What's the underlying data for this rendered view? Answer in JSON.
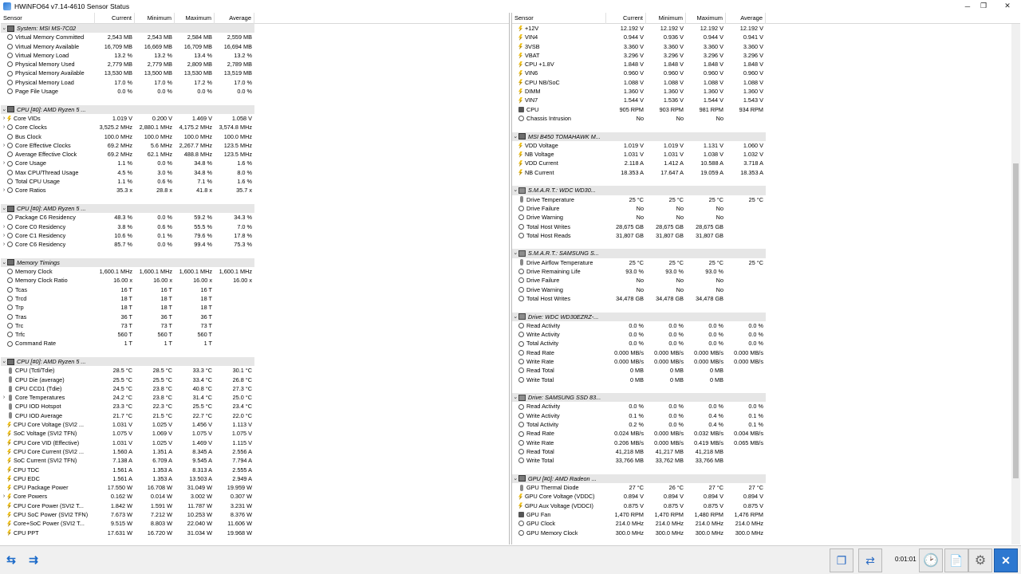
{
  "window": {
    "title": "HWiNFO64 v7.14-4610 Sensor Status"
  },
  "columns": [
    "Sensor",
    "Current",
    "Minimum",
    "Maximum",
    "Average"
  ],
  "left_rows": [
    {
      "t": "sec",
      "name": "System: MSI MS-7C02",
      "icon": "chip"
    },
    {
      "name": "Virtual Memory Committed",
      "icon": "circ",
      "v": [
        "2,543 MB",
        "2,543 MB",
        "2,584 MB",
        "2,559 MB"
      ]
    },
    {
      "name": "Virtual Memory Available",
      "icon": "circ",
      "v": [
        "16,709 MB",
        "16,669 MB",
        "16,709 MB",
        "16,694 MB"
      ]
    },
    {
      "name": "Virtual Memory Load",
      "icon": "circ",
      "v": [
        "13.2 %",
        "13.2 %",
        "13.4 %",
        "13.2 %"
      ]
    },
    {
      "name": "Physical Memory Used",
      "icon": "circ",
      "v": [
        "2,779 MB",
        "2,779 MB",
        "2,809 MB",
        "2,789 MB"
      ]
    },
    {
      "name": "Physical Memory Available",
      "icon": "circ",
      "v": [
        "13,530 MB",
        "13,500 MB",
        "13,530 MB",
        "13,519 MB"
      ]
    },
    {
      "name": "Physical Memory Load",
      "icon": "circ",
      "v": [
        "17.0 %",
        "17.0 %",
        "17.2 %",
        "17.0 %"
      ]
    },
    {
      "name": "Page File Usage",
      "icon": "circ",
      "v": [
        "0.0 %",
        "0.0 %",
        "0.0 %",
        "0.0 %"
      ]
    },
    {
      "t": "sp"
    },
    {
      "t": "sec",
      "name": "CPU [#0]: AMD Ryzen 5 ...",
      "icon": "chip"
    },
    {
      "name": "Core VIDs",
      "icon": "volt",
      "tw": ">",
      "v": [
        "1.019 V",
        "0.200 V",
        "1.469 V",
        "1.058 V"
      ]
    },
    {
      "name": "Core Clocks",
      "icon": "circ",
      "tw": ">",
      "v": [
        "3,525.2 MHz",
        "2,880.1 MHz",
        "4,175.2 MHz",
        "3,574.8 MHz"
      ]
    },
    {
      "name": "Bus Clock",
      "icon": "circ",
      "v": [
        "100.0 MHz",
        "100.0 MHz",
        "100.0 MHz",
        "100.0 MHz"
      ]
    },
    {
      "name": "Core Effective Clocks",
      "icon": "circ",
      "tw": ">",
      "v": [
        "69.2 MHz",
        "5.6 MHz",
        "2,267.7 MHz",
        "123.5 MHz"
      ]
    },
    {
      "name": "Average Effective Clock",
      "icon": "circ",
      "v": [
        "69.2 MHz",
        "62.1 MHz",
        "488.8 MHz",
        "123.5 MHz"
      ]
    },
    {
      "name": "Core Usage",
      "icon": "circ",
      "tw": ">",
      "v": [
        "1.1 %",
        "0.0 %",
        "34.8 %",
        "1.6 %"
      ]
    },
    {
      "name": "Max CPU/Thread Usage",
      "icon": "circ",
      "v": [
        "4.5 %",
        "3.0 %",
        "34.8 %",
        "8.0 %"
      ]
    },
    {
      "name": "Total CPU Usage",
      "icon": "circ",
      "v": [
        "1.1 %",
        "0.6 %",
        "7.1 %",
        "1.6 %"
      ]
    },
    {
      "name": "Core Ratios",
      "icon": "circ",
      "tw": ">",
      "v": [
        "35.3 x",
        "28.8 x",
        "41.8 x",
        "35.7 x"
      ]
    },
    {
      "t": "sp"
    },
    {
      "t": "sec",
      "name": "CPU [#0]: AMD Ryzen 5 ...",
      "icon": "chip"
    },
    {
      "name": "Package C6 Residency",
      "icon": "circ",
      "v": [
        "48.3 %",
        "0.0 %",
        "59.2 %",
        "34.3 %"
      ]
    },
    {
      "name": "Core C0 Residency",
      "icon": "circ",
      "tw": ">",
      "v": [
        "3.8 %",
        "0.6 %",
        "55.5 %",
        "7.0 %"
      ]
    },
    {
      "name": "Core C1 Residency",
      "icon": "circ",
      "tw": ">",
      "v": [
        "10.6 %",
        "0.1 %",
        "79.6 %",
        "17.8 %"
      ]
    },
    {
      "name": "Core C6 Residency",
      "icon": "circ",
      "tw": ">",
      "v": [
        "85.7 %",
        "0.0 %",
        "99.4 %",
        "75.3 %"
      ]
    },
    {
      "t": "sp"
    },
    {
      "t": "sec",
      "name": "Memory Timings",
      "icon": "chip"
    },
    {
      "name": "Memory Clock",
      "icon": "circ",
      "v": [
        "1,600.1 MHz",
        "1,600.1 MHz",
        "1,600.1 MHz",
        "1,600.1 MHz"
      ]
    },
    {
      "name": "Memory Clock Ratio",
      "icon": "circ",
      "v": [
        "16.00 x",
        "16.00 x",
        "16.00 x",
        "16.00 x"
      ]
    },
    {
      "name": "Tcas",
      "icon": "circ",
      "v": [
        "16 T",
        "16 T",
        "16 T",
        ""
      ]
    },
    {
      "name": "Trcd",
      "icon": "circ",
      "v": [
        "18 T",
        "18 T",
        "18 T",
        ""
      ]
    },
    {
      "name": "Trp",
      "icon": "circ",
      "v": [
        "18 T",
        "18 T",
        "18 T",
        ""
      ]
    },
    {
      "name": "Tras",
      "icon": "circ",
      "v": [
        "36 T",
        "36 T",
        "36 T",
        ""
      ]
    },
    {
      "name": "Trc",
      "icon": "circ",
      "v": [
        "73 T",
        "73 T",
        "73 T",
        ""
      ]
    },
    {
      "name": "Trfc",
      "icon": "circ",
      "v": [
        "560 T",
        "560 T",
        "560 T",
        ""
      ]
    },
    {
      "name": "Command Rate",
      "icon": "circ",
      "v": [
        "1 T",
        "1 T",
        "1 T",
        ""
      ]
    },
    {
      "t": "sp"
    },
    {
      "t": "sec",
      "name": "CPU [#0]: AMD Ryzen 5 ...",
      "icon": "chip"
    },
    {
      "name": "CPU (Tctl/Tdie)",
      "icon": "temp",
      "v": [
        "28.5 °C",
        "28.5 °C",
        "33.3 °C",
        "30.1 °C"
      ]
    },
    {
      "name": "CPU Die (average)",
      "icon": "temp",
      "v": [
        "25.5 °C",
        "25.5 °C",
        "33.4 °C",
        "26.8 °C"
      ]
    },
    {
      "name": "CPU CCD1 (Tdie)",
      "icon": "temp",
      "v": [
        "24.5 °C",
        "23.8 °C",
        "40.8 °C",
        "27.3 °C"
      ]
    },
    {
      "name": "Core Temperatures",
      "icon": "temp",
      "tw": ">",
      "v": [
        "24.2 °C",
        "23.8 °C",
        "31.4 °C",
        "25.0 °C"
      ]
    },
    {
      "name": "CPU IOD Hotspot",
      "icon": "temp",
      "v": [
        "23.3 °C",
        "22.3 °C",
        "25.5 °C",
        "23.4 °C"
      ]
    },
    {
      "name": "CPU IOD Average",
      "icon": "temp",
      "v": [
        "21.7 °C",
        "21.5 °C",
        "22.7 °C",
        "22.0 °C"
      ]
    },
    {
      "name": "CPU Core Voltage (SVI2 ...",
      "icon": "volt",
      "v": [
        "1.031 V",
        "1.025 V",
        "1.456 V",
        "1.113 V"
      ]
    },
    {
      "name": "SoC Voltage (SVI2 TFN)",
      "icon": "volt",
      "v": [
        "1.075 V",
        "1.069 V",
        "1.075 V",
        "1.075 V"
      ]
    },
    {
      "name": "CPU Core VID (Effective)",
      "icon": "volt",
      "v": [
        "1.031 V",
        "1.025 V",
        "1.469 V",
        "1.115 V"
      ]
    },
    {
      "name": "CPU Core Current (SVI2 ...",
      "icon": "volt",
      "v": [
        "1.560 A",
        "1.351 A",
        "8.345 A",
        "2.556 A"
      ]
    },
    {
      "name": "SoC Current (SVI2 TFN)",
      "icon": "volt",
      "v": [
        "7.138 A",
        "6.709 A",
        "9.545 A",
        "7.794 A"
      ]
    },
    {
      "name": "CPU TDC",
      "icon": "volt",
      "v": [
        "1.561 A",
        "1.353 A",
        "8.313 A",
        "2.555 A"
      ]
    },
    {
      "name": "CPU EDC",
      "icon": "volt",
      "v": [
        "1.561 A",
        "1.353 A",
        "13.503 A",
        "2.949 A"
      ]
    },
    {
      "name": "CPU Package Power",
      "icon": "volt",
      "v": [
        "17.550 W",
        "16.708 W",
        "31.049 W",
        "19.959 W"
      ]
    },
    {
      "name": "Core Powers",
      "icon": "volt",
      "tw": ">",
      "v": [
        "0.162 W",
        "0.014 W",
        "3.002 W",
        "0.307 W"
      ]
    },
    {
      "name": "CPU Core Power (SVI2 T...",
      "icon": "volt",
      "v": [
        "1.842 W",
        "1.591 W",
        "11.787 W",
        "3.231 W"
      ]
    },
    {
      "name": "CPU SoC Power (SVI2 TFN)",
      "icon": "volt",
      "v": [
        "7.673 W",
        "7.212 W",
        "10.253 W",
        "8.376 W"
      ]
    },
    {
      "name": "Core+SoC Power (SVI2 T...",
      "icon": "volt",
      "v": [
        "9.515 W",
        "8.803 W",
        "22.040 W",
        "11.606 W"
      ]
    },
    {
      "name": "CPU PPT",
      "icon": "volt",
      "v": [
        "17.631 W",
        "16.720 W",
        "31.034 W",
        "19.968 W"
      ]
    }
  ],
  "right_rows": [
    {
      "name": "+12V",
      "icon": "volt",
      "v": [
        "12.192 V",
        "12.192 V",
        "12.192 V",
        "12.192 V"
      ]
    },
    {
      "name": "VIN4",
      "icon": "volt",
      "v": [
        "0.944 V",
        "0.936 V",
        "0.944 V",
        "0.941 V"
      ]
    },
    {
      "name": "3VSB",
      "icon": "volt",
      "v": [
        "3.360 V",
        "3.360 V",
        "3.360 V",
        "3.360 V"
      ]
    },
    {
      "name": "VBAT",
      "icon": "volt",
      "v": [
        "3.296 V",
        "3.296 V",
        "3.296 V",
        "3.296 V"
      ]
    },
    {
      "name": "CPU +1.8V",
      "icon": "volt",
      "v": [
        "1.848 V",
        "1.848 V",
        "1.848 V",
        "1.848 V"
      ]
    },
    {
      "name": "VIN6",
      "icon": "volt",
      "v": [
        "0.960 V",
        "0.960 V",
        "0.960 V",
        "0.960 V"
      ]
    },
    {
      "name": "CPU NB/SoC",
      "icon": "volt",
      "v": [
        "1.088 V",
        "1.088 V",
        "1.088 V",
        "1.088 V"
      ]
    },
    {
      "name": "DIMM",
      "icon": "volt",
      "v": [
        "1.360 V",
        "1.360 V",
        "1.360 V",
        "1.360 V"
      ]
    },
    {
      "name": "VIN7",
      "icon": "volt",
      "v": [
        "1.544 V",
        "1.536 V",
        "1.544 V",
        "1.543 V"
      ]
    },
    {
      "name": "CPU",
      "icon": "fan",
      "v": [
        "905 RPM",
        "903 RPM",
        "981 RPM",
        "934 RPM"
      ]
    },
    {
      "name": "Chassis Intrusion",
      "icon": "circ",
      "v": [
        "No",
        "No",
        "No",
        ""
      ]
    },
    {
      "t": "sp"
    },
    {
      "t": "sec",
      "name": "MSI B450 TOMAHAWK M...",
      "icon": "chip"
    },
    {
      "name": "VDD Voltage",
      "icon": "volt",
      "v": [
        "1.019 V",
        "1.019 V",
        "1.131 V",
        "1.060 V"
      ]
    },
    {
      "name": "NB Voltage",
      "icon": "volt",
      "v": [
        "1.031 V",
        "1.031 V",
        "1.038 V",
        "1.032 V"
      ]
    },
    {
      "name": "VDD Current",
      "icon": "volt",
      "v": [
        "2.118 A",
        "1.412 A",
        "10.588 A",
        "3.718 A"
      ]
    },
    {
      "name": "NB Current",
      "icon": "volt",
      "v": [
        "18.353 A",
        "17.647 A",
        "19.059 A",
        "18.353 A"
      ]
    },
    {
      "t": "sp"
    },
    {
      "t": "sec",
      "name": "S.M.A.R.T.: WDC WD30...",
      "icon": "disk"
    },
    {
      "name": "Drive Temperature",
      "icon": "temp",
      "v": [
        "25 °C",
        "25 °C",
        "25 °C",
        "25 °C"
      ]
    },
    {
      "name": "Drive Failure",
      "icon": "circ",
      "v": [
        "No",
        "No",
        "No",
        ""
      ]
    },
    {
      "name": "Drive Warning",
      "icon": "circ",
      "v": [
        "No",
        "No",
        "No",
        ""
      ]
    },
    {
      "name": "Total Host Writes",
      "icon": "circ",
      "v": [
        "28,675 GB",
        "28,675 GB",
        "28,675 GB",
        ""
      ]
    },
    {
      "name": "Total Host Reads",
      "icon": "circ",
      "v": [
        "31,807 GB",
        "31,807 GB",
        "31,807 GB",
        ""
      ]
    },
    {
      "t": "sp"
    },
    {
      "t": "sec",
      "name": "S.M.A.R.T.: SAMSUNG S...",
      "icon": "disk"
    },
    {
      "name": "Drive Airflow Temperature",
      "icon": "temp",
      "v": [
        "25 °C",
        "25 °C",
        "25 °C",
        "25 °C"
      ]
    },
    {
      "name": "Drive Remaining Life",
      "icon": "circ",
      "v": [
        "93.0 %",
        "93.0 %",
        "93.0 %",
        ""
      ]
    },
    {
      "name": "Drive Failure",
      "icon": "circ",
      "v": [
        "No",
        "No",
        "No",
        ""
      ]
    },
    {
      "name": "Drive Warning",
      "icon": "circ",
      "v": [
        "No",
        "No",
        "No",
        ""
      ]
    },
    {
      "name": "Total Host Writes",
      "icon": "circ",
      "v": [
        "34,478 GB",
        "34,478 GB",
        "34,478 GB",
        ""
      ]
    },
    {
      "t": "sp"
    },
    {
      "t": "sec",
      "name": "Drive: WDC WD30EZRZ-...",
      "icon": "disk"
    },
    {
      "name": "Read Activity",
      "icon": "circ",
      "v": [
        "0.0 %",
        "0.0 %",
        "0.0 %",
        "0.0 %"
      ]
    },
    {
      "name": "Write Activity",
      "icon": "circ",
      "v": [
        "0.0 %",
        "0.0 %",
        "0.0 %",
        "0.0 %"
      ]
    },
    {
      "name": "Total Activity",
      "icon": "circ",
      "v": [
        "0.0 %",
        "0.0 %",
        "0.0 %",
        "0.0 %"
      ]
    },
    {
      "name": "Read Rate",
      "icon": "circ",
      "v": [
        "0.000 MB/s",
        "0.000 MB/s",
        "0.000 MB/s",
        "0.000 MB/s"
      ]
    },
    {
      "name": "Write Rate",
      "icon": "circ",
      "v": [
        "0.000 MB/s",
        "0.000 MB/s",
        "0.000 MB/s",
        "0.000 MB/s"
      ]
    },
    {
      "name": "Read Total",
      "icon": "circ",
      "v": [
        "0 MB",
        "0 MB",
        "0 MB",
        ""
      ]
    },
    {
      "name": "Write Total",
      "icon": "circ",
      "v": [
        "0 MB",
        "0 MB",
        "0 MB",
        ""
      ]
    },
    {
      "t": "sp"
    },
    {
      "t": "sec",
      "name": "Drive: SAMSUNG SSD 83...",
      "icon": "disk"
    },
    {
      "name": "Read Activity",
      "icon": "circ",
      "v": [
        "0.0 %",
        "0.0 %",
        "0.0 %",
        "0.0 %"
      ]
    },
    {
      "name": "Write Activity",
      "icon": "circ",
      "v": [
        "0.1 %",
        "0.0 %",
        "0.4 %",
        "0.1 %"
      ]
    },
    {
      "name": "Total Activity",
      "icon": "circ",
      "v": [
        "0.2 %",
        "0.0 %",
        "0.4 %",
        "0.1 %"
      ]
    },
    {
      "name": "Read Rate",
      "icon": "circ",
      "v": [
        "0.024 MB/s",
        "0.000 MB/s",
        "0.032 MB/s",
        "0.004 MB/s"
      ]
    },
    {
      "name": "Write Rate",
      "icon": "circ",
      "v": [
        "0.206 MB/s",
        "0.000 MB/s",
        "0.419 MB/s",
        "0.065 MB/s"
      ]
    },
    {
      "name": "Read Total",
      "icon": "circ",
      "v": [
        "41,218 MB",
        "41,217 MB",
        "41,218 MB",
        ""
      ]
    },
    {
      "name": "Write Total",
      "icon": "circ",
      "v": [
        "33,766 MB",
        "33,762 MB",
        "33,766 MB",
        ""
      ]
    },
    {
      "t": "sp"
    },
    {
      "t": "sec",
      "name": "GPU [#0]: AMD Radeon ...",
      "icon": "gpu"
    },
    {
      "name": "GPU Thermal Diode",
      "icon": "temp",
      "v": [
        "27 °C",
        "26 °C",
        "27 °C",
        "27 °C"
      ]
    },
    {
      "name": "GPU Core Voltage (VDDC)",
      "icon": "volt",
      "v": [
        "0.894 V",
        "0.894 V",
        "0.894 V",
        "0.894 V"
      ]
    },
    {
      "name": "GPU Aux Voltage (VDDCI)",
      "icon": "volt",
      "v": [
        "0.875 V",
        "0.875 V",
        "0.875 V",
        "0.875 V"
      ]
    },
    {
      "name": "GPU Fan",
      "icon": "fan",
      "v": [
        "1,470 RPM",
        "1,470 RPM",
        "1,480 RPM",
        "1,476 RPM"
      ]
    },
    {
      "name": "GPU Clock",
      "icon": "circ",
      "v": [
        "214.0 MHz",
        "214.0 MHz",
        "214.0 MHz",
        "214.0 MHz"
      ]
    },
    {
      "name": "GPU Memory Clock",
      "icon": "circ",
      "v": [
        "300.0 MHz",
        "300.0 MHz",
        "300.0 MHz",
        "300.0 MHz"
      ]
    }
  ],
  "footer": {
    "timer": "0:01:01"
  }
}
